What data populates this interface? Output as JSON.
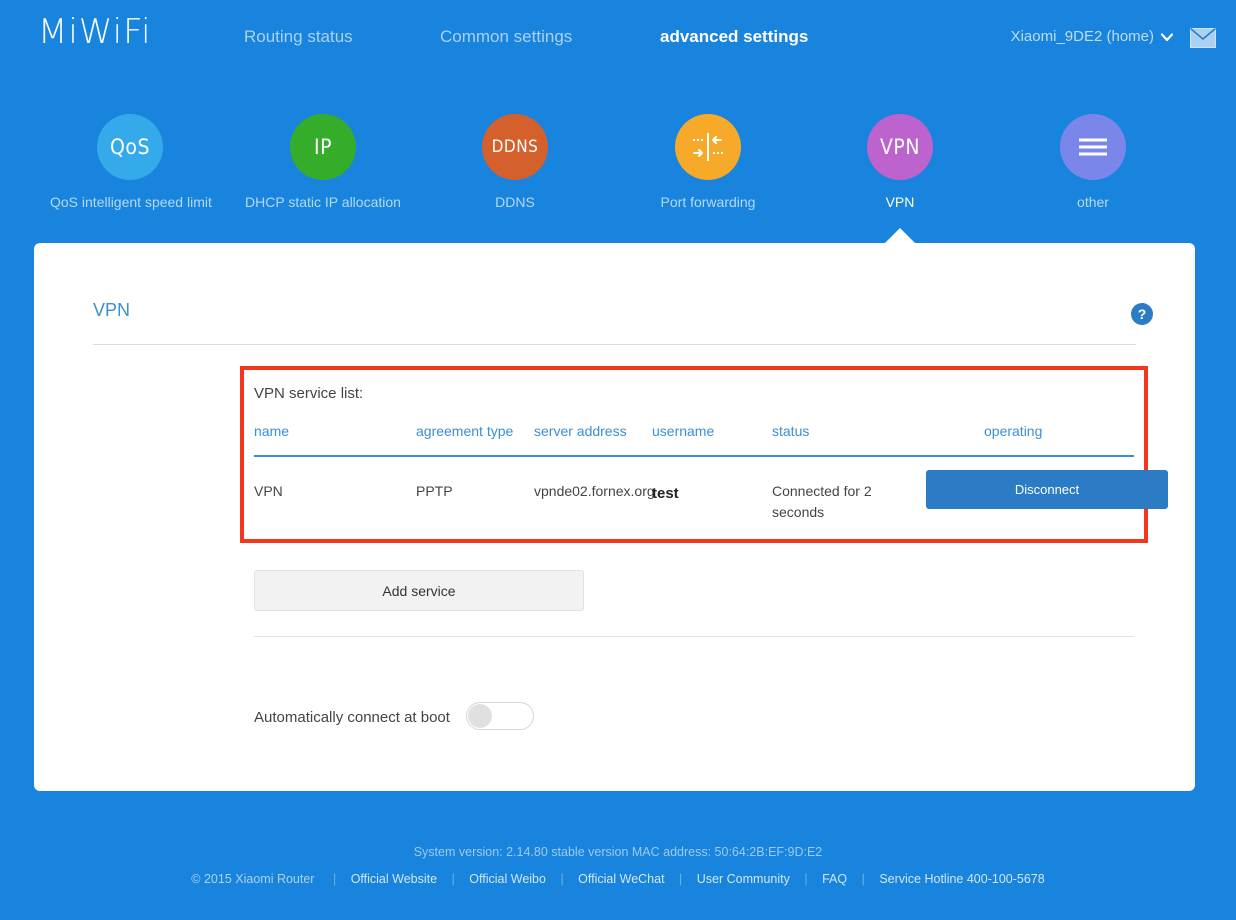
{
  "header": {
    "logo": "MiWiFi",
    "nav": [
      {
        "label": "Routing status",
        "active": false
      },
      {
        "label": "Common settings",
        "active": false
      },
      {
        "label": "advanced settings",
        "active": true
      }
    ],
    "account": "Xiaomi_9DE2 (home)",
    "caret_icon": "chevron-down-icon",
    "mail_icon": "mail-icon"
  },
  "iconrow": [
    {
      "glyph": "QoS",
      "label": "QoS intelligent speed limit",
      "color": "#35aaeb",
      "icon": "qos-icon",
      "active": false
    },
    {
      "glyph": "IP",
      "label": "DHCP static IP allocation",
      "color": "#35ad2a",
      "icon": "ip-icon",
      "active": false
    },
    {
      "glyph": "DDNS",
      "label": "DDNS",
      "color": "#d4602c",
      "icon": "ddns-icon",
      "active": false
    },
    {
      "glyph": "",
      "label": "Port forwarding",
      "color": "#f7a929",
      "icon": "port-forwarding-icon",
      "active": false
    },
    {
      "glyph": "VPN",
      "label": "VPN",
      "color": "#bc63cd",
      "icon": "vpn-icon",
      "active": true
    },
    {
      "glyph": "",
      "label": "other",
      "color": "#7b86ea",
      "icon": "hamburger-icon",
      "active": false
    }
  ],
  "card": {
    "title": "VPN",
    "help_label": "?",
    "list_label": "VPN service list:",
    "table": {
      "columns": [
        "name",
        "agreement type",
        "server address",
        "username",
        "status",
        "operating"
      ],
      "rows": [
        {
          "name": "VPN",
          "agreement_type": "PPTP",
          "server_address": "vpnde02.fornex.org",
          "username": "test",
          "status": "Connected for 2 seconds",
          "action_label": "Disconnect"
        }
      ]
    },
    "add_service_label": "Add service",
    "auto_connect_label": "Automatically connect at boot",
    "auto_connect_on": false
  },
  "footer": {
    "system_version": "System version: 2.14.80 stable version MAC address: 50:64:2B:EF:9D:E2",
    "copyright": "© 2015 Xiaomi Router",
    "links": [
      "Official Website",
      "Official Weibo",
      "Official WeChat",
      "User Community",
      "FAQ",
      "Service Hotline 400-100-5678"
    ],
    "separator": "|"
  },
  "colors": {
    "background": "#1884dd",
    "accent": "#3a8fd8",
    "highlight": "#f4361a",
    "button": "#2b7cc4"
  }
}
